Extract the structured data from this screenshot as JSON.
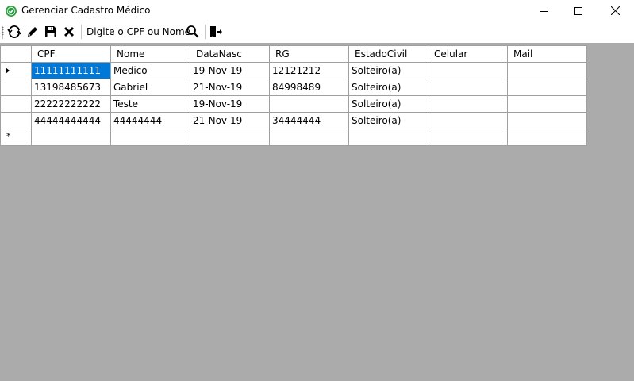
{
  "window": {
    "title": "Gerenciar Cadastro Médico",
    "accent": "#2ea043"
  },
  "toolbar": {
    "search_label": "Digite o CPF ou Nome",
    "icons": [
      "refresh-icon",
      "edit-icon",
      "save-icon",
      "delete-icon",
      "search-icon",
      "exit-icon"
    ]
  },
  "grid": {
    "columns": [
      "CPF",
      "Nome",
      "DataNasc",
      "RG",
      "EstadoCivil",
      "Celular",
      "Mail"
    ],
    "rows": [
      {
        "cpf": "11111111111",
        "nome": "Medico",
        "datanasc": "19-Nov-19",
        "rg": "12121212",
        "estadocivil": "Solteiro(a)",
        "celular": "",
        "mail": ""
      },
      {
        "cpf": "13198485673",
        "nome": "Gabriel",
        "datanasc": "21-Nov-19",
        "rg": "84998489",
        "estadocivil": "Solteiro(a)",
        "celular": "",
        "mail": ""
      },
      {
        "cpf": "22222222222",
        "nome": "Teste",
        "datanasc": "19-Nov-19",
        "rg": "",
        "estadocivil": "Solteiro(a)",
        "celular": "",
        "mail": ""
      },
      {
        "cpf": "44444444444",
        "nome": "44444444",
        "datanasc": "21-Nov-19",
        "rg": "34444444",
        "estadocivil": "Solteiro(a)",
        "celular": "",
        "mail": ""
      }
    ],
    "new_row_marker": "*",
    "selection_color": "#0078d7"
  }
}
